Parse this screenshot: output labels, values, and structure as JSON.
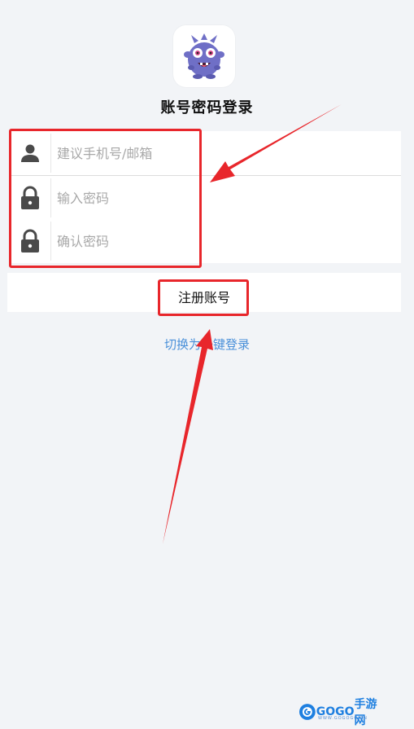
{
  "page": {
    "title": "账号密码登录",
    "app_icon": "monster-mascot-icon"
  },
  "form": {
    "account_placeholder": "建议手机号/邮箱",
    "password_placeholder": "输入密码",
    "confirm_placeholder": "确认密码",
    "account_icon": "person-icon",
    "password_icon": "lock-icon",
    "confirm_icon": "lock-icon"
  },
  "register_label": "注册账号",
  "switch_link": "切换为一键登录",
  "watermark": {
    "brand": "GOGO",
    "suffix": "手游网",
    "url": "WWW.GOGOGO.CN"
  },
  "colors": {
    "background": "#f2f4f7",
    "link": "#4a90d9",
    "annotation": "#e8262b"
  }
}
